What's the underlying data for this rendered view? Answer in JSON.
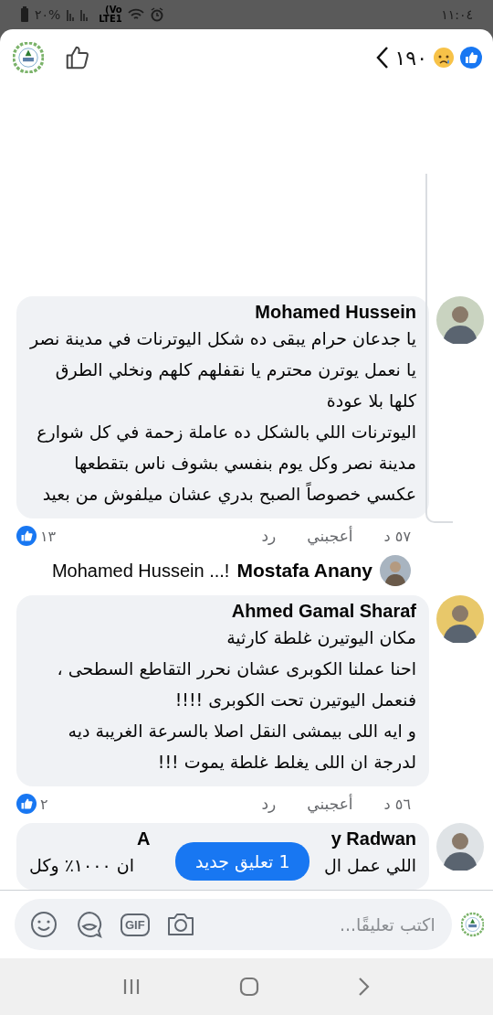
{
  "status_bar": {
    "time": "١١:٠٤",
    "battery": "%٢٠",
    "network_top": "Vo)",
    "network_bottom": "LTE1"
  },
  "header": {
    "reaction_count": "١٩٠",
    "liked": false
  },
  "comments": [
    {
      "kind": "full",
      "author": "Mohamed Hussein",
      "paragraphs": [
        "يا جدعان حرام يبقى ده شكل اليوترنات في مدينة نصر",
        "يا نعمل يوترن محترم يا نقفلهم كلهم ونخلي الطرق كلها بلا عودة",
        "اليوترنات اللي بالشكل ده عاملة زحمة في كل شوارع مدينة نصر وكل يوم بنفسي بشوف ناس بتقطعها عكسي خصوصاً الصبح بدري عشان ميلفوش من بعيد"
      ],
      "time": "٥٧ د",
      "like": "أعجبني",
      "reply": "رد",
      "reactions": "١٣",
      "has_replies": true,
      "reply_preview": {
        "author": "Mostafa Anany",
        "text": "Mohamed Hussein ...!"
      }
    },
    {
      "kind": "full",
      "author": "Ahmed Gamal Sharaf",
      "paragraphs": [
        "مكان اليوتيرن غلطة كارثية",
        "احنا عملنا الكوبرى عشان نحرر التقاطع السطحى ، فنعمل اليوتيرن تحت الكوبرى !!!!",
        "و ايه اللى بيمشى النقل اصلا بالسرعة الغريبة ديه",
        "لدرجة ان اللى يغلط غلطة يموت !!!"
      ],
      "time": "٥٦ د",
      "like": "أعجبني",
      "reply": "رد",
      "reactions": "٢",
      "has_replies": false
    },
    {
      "kind": "covered",
      "author_start": "A",
      "author_end": "y Radwan",
      "text_start": "اللي عمل ال",
      "text_end": "ان ١٠٠٠٪ وكل"
    }
  ],
  "new_comments_pill": "1 تعليق جديد",
  "composer": {
    "placeholder": "اكتب تعليقًا...",
    "gif": "GIF"
  }
}
